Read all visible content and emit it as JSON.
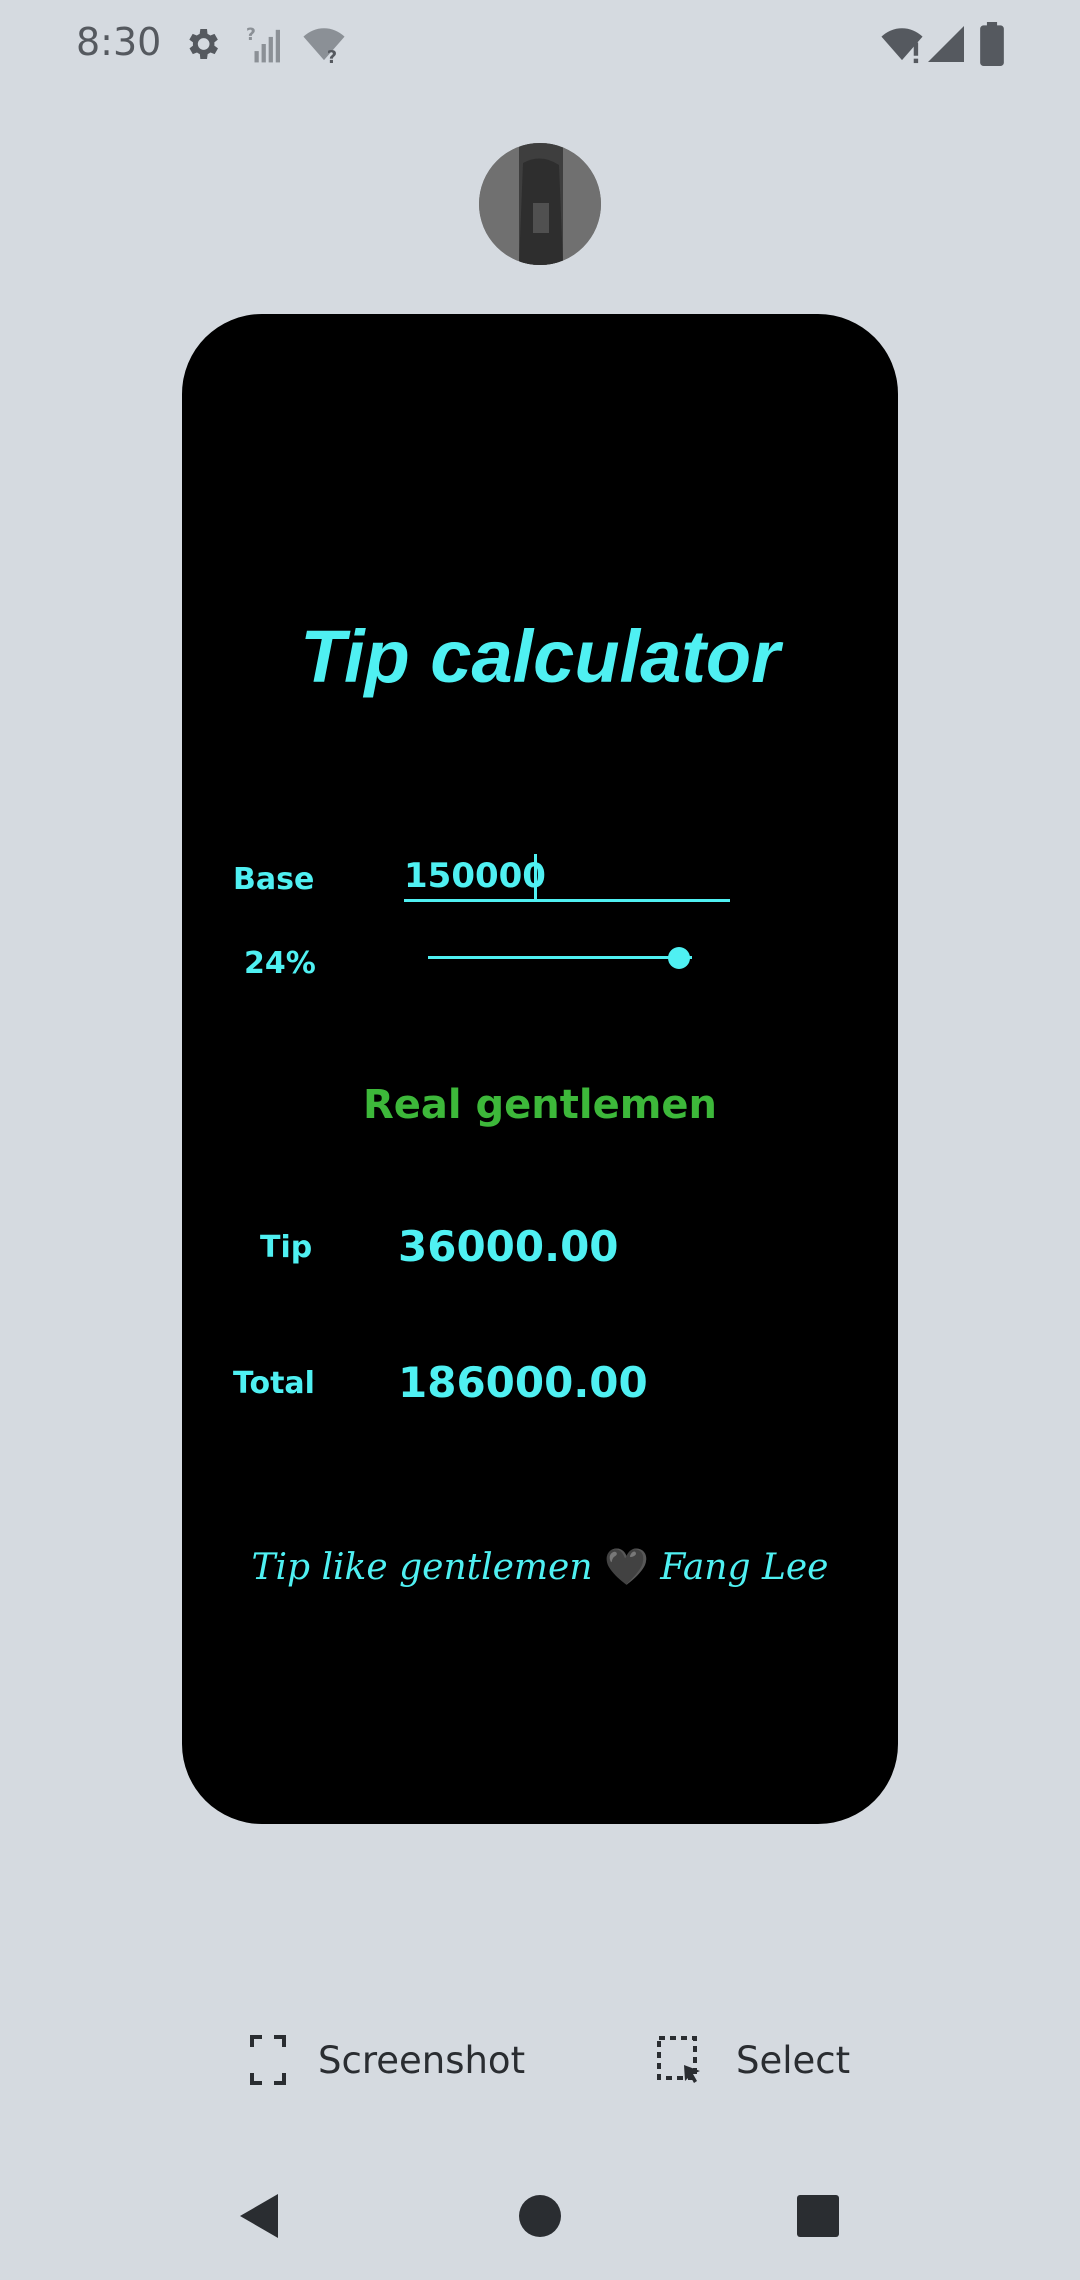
{
  "status_bar": {
    "time": "8:30"
  },
  "app": {
    "title": "Tip calculator",
    "base": {
      "label": "Base",
      "value": "150000"
    },
    "percent": {
      "label": "24%",
      "slider_value_fraction": 0.95
    },
    "tier_message": "Real gentlemen",
    "tip": {
      "label": "Tip",
      "value": "36000.00"
    },
    "total": {
      "label": "Total",
      "value": "186000.00"
    },
    "footer": {
      "text_before": "Tip like gentlemen",
      "heart": "🖤",
      "text_after": "Fang Lee"
    }
  },
  "toolbar": {
    "screenshot_label": "Screenshot",
    "select_label": "Select"
  },
  "colors": {
    "accent": "#4ff0f2",
    "tier": "#3db83a",
    "card_bg": "#000000",
    "page_bg": "#d5dae0"
  },
  "icons": {
    "status": [
      "settings-icon",
      "no-sim-signal-icon",
      "wifi-unknown-icon",
      "wifi-alert-icon",
      "cell-signal-icon",
      "battery-icon"
    ],
    "nav": [
      "back-icon",
      "home-icon",
      "recents-icon"
    ]
  }
}
